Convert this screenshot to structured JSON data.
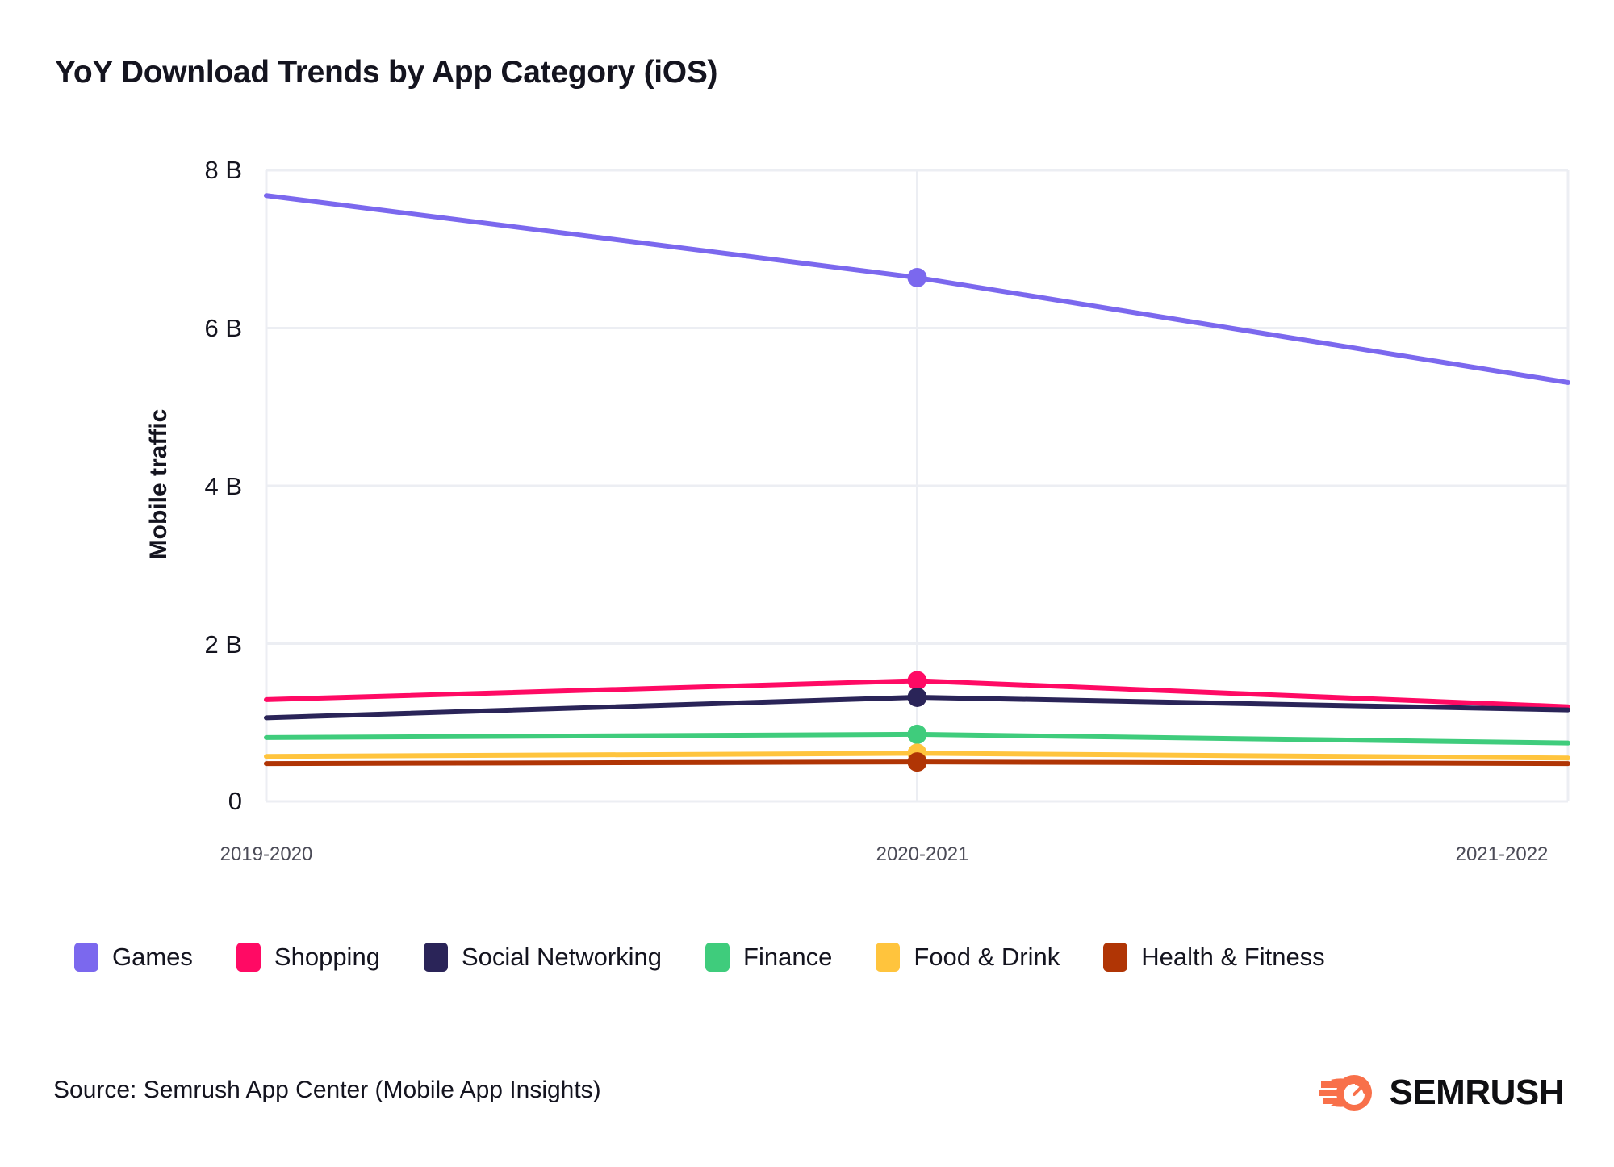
{
  "header": {
    "title": "YoY Download Trends by App Category (iOS)"
  },
  "footer": {
    "source": "Source: Semrush App Center (Mobile App Insights)",
    "logo_text": "SEMRUSH",
    "logo_icon": "semrush-comet-icon",
    "logo_color": "#f8704a"
  },
  "axes": {
    "ylabel": "Mobile traffic",
    "yticks": [
      "0",
      "2 B",
      "4 B",
      "6 B",
      "8 B"
    ],
    "xticks": [
      "2019-2020",
      "2020-2021",
      "2021-2022"
    ]
  },
  "legend": {
    "position": "bottom-left",
    "items": [
      {
        "label": "Games",
        "color": "#7b68ee"
      },
      {
        "label": "Shopping",
        "color": "#ff0a64"
      },
      {
        "label": "Social Networking",
        "color": "#2a2458"
      },
      {
        "label": "Finance",
        "color": "#3fcc7c"
      },
      {
        "label": "Food & Drink",
        "color": "#ffc43d"
      },
      {
        "label": "Health & Fitness",
        "color": "#b03505"
      }
    ]
  },
  "chart_data": {
    "type": "line",
    "title": "YoY Download Trends by App Category (iOS)",
    "xlabel": "",
    "ylabel": "Mobile traffic",
    "categories": [
      "2019-2020",
      "2020-2021",
      "2021-2022"
    ],
    "ylim": [
      0,
      8.2
    ],
    "ytick_values": [
      0,
      2,
      4,
      6,
      8
    ],
    "yunit": "B",
    "grid": "horizontal-and-vertical",
    "markers_on": [
      "2020-2021"
    ],
    "series": [
      {
        "name": "Games",
        "color": "#7b68ee",
        "values": [
          7.68,
          6.64,
          5.31
        ]
      },
      {
        "name": "Shopping",
        "color": "#ff0a64",
        "values": [
          1.29,
          1.53,
          1.2
        ]
      },
      {
        "name": "Social Networking",
        "color": "#2a2458",
        "values": [
          1.06,
          1.32,
          1.16
        ]
      },
      {
        "name": "Finance",
        "color": "#3fcc7c",
        "values": [
          0.81,
          0.85,
          0.74
        ]
      },
      {
        "name": "Food & Drink",
        "color": "#ffc43d",
        "values": [
          0.57,
          0.61,
          0.55
        ]
      },
      {
        "name": "Health & Fitness",
        "color": "#b03505",
        "values": [
          0.48,
          0.5,
          0.48
        ]
      }
    ]
  }
}
